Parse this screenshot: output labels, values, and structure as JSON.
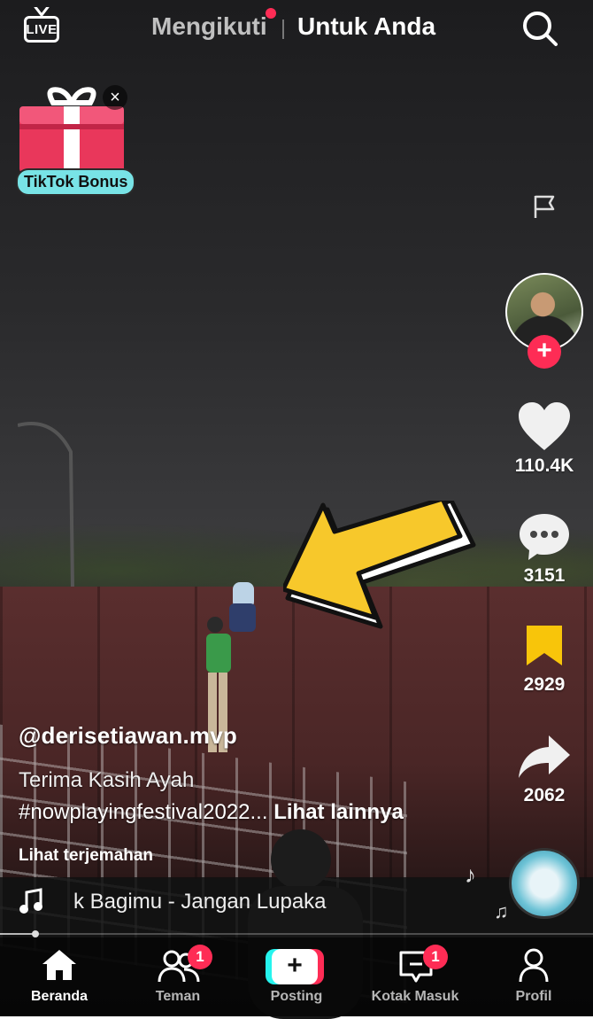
{
  "top_nav": {
    "live_label": "LIVE",
    "following_label": "Mengikuti",
    "for_you_label": "Untuk Anda",
    "has_following_update": true
  },
  "bonus": {
    "label": "TikTok Bonus",
    "close_icon": "×"
  },
  "actions": {
    "likes": "110.4K",
    "comments": "3151",
    "favorites": "2929",
    "shares": "2062"
  },
  "video": {
    "username": "@derisetiawan.mvp",
    "caption_line1": "Terima Kasih Ayah",
    "caption_line2": "#nowplayingfestival2022...",
    "see_more": "Lihat lainnya",
    "translate": "Lihat terjemahan",
    "music": "k Bagimu - Jangan Lupaka",
    "progress": 0.06
  },
  "bottom_nav": [
    {
      "label": "Beranda",
      "icon": "home-icon",
      "badge": ""
    },
    {
      "label": "Teman",
      "icon": "friends-icon",
      "badge": "1"
    },
    {
      "label": "Posting",
      "icon": "post-icon",
      "badge": ""
    },
    {
      "label": "Kotak Masuk",
      "icon": "inbox-icon",
      "badge": "1"
    },
    {
      "label": "Profil",
      "icon": "profile-icon",
      "badge": ""
    }
  ],
  "colors": {
    "accent": "#fe2c55",
    "bookmark": "#f8c50a",
    "arrow": "#f7c82b",
    "bonus_pill": "#78e3e6"
  }
}
